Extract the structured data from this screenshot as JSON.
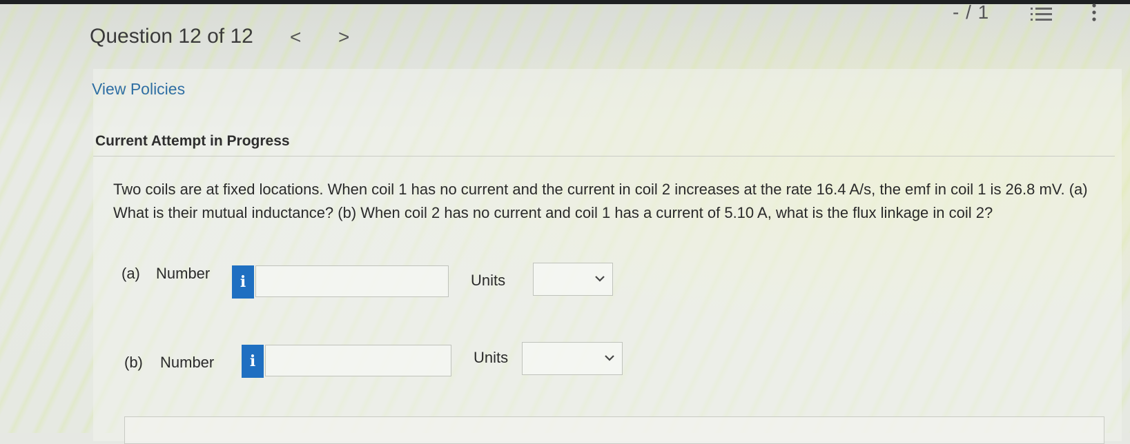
{
  "header": {
    "question_title": "Question 12 of 12",
    "prev_arrow": "<",
    "next_arrow": ">",
    "score": "- / 1"
  },
  "links": {
    "view_policies": "View Policies"
  },
  "section": {
    "attempt_title": "Current Attempt in Progress"
  },
  "question": {
    "text": "Two coils are at fixed locations. When coil 1 has no current and the current in coil 2 increases at the rate 16.4 A/s, the emf in coil 1 is 26.8 mV. (a) What is their mutual inductance? (b) When coil 2 has no current and coil 1 has a current of 5.10 A, what is the flux linkage in coil 2?"
  },
  "parts": [
    {
      "label": "(a)",
      "number_label": "Number",
      "info": "i",
      "value": "",
      "units_label": "Units",
      "units_value": ""
    },
    {
      "label": "(b)",
      "number_label": "Number",
      "info": "i",
      "value": "",
      "units_label": "Units",
      "units_value": ""
    }
  ],
  "icons": [
    "chevron-left-icon",
    "chevron-right-icon",
    "list-icon",
    "more-vertical-icon",
    "info-icon",
    "chevron-down-icon"
  ],
  "colors": {
    "link": "#2f6ea3",
    "info_button": "#1f6fc1"
  }
}
